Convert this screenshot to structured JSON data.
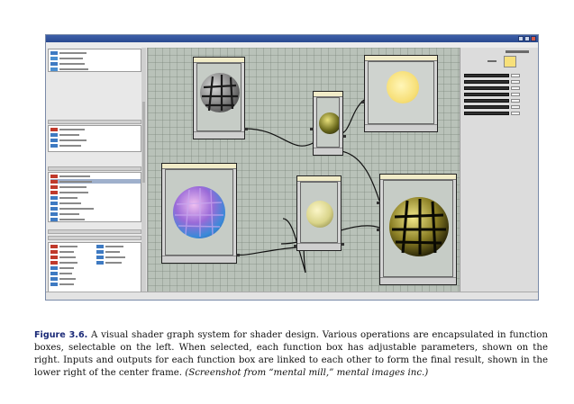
{
  "caption": {
    "label": "Figure 3.6.",
    "text": " A visual shader graph system for shader design. Various operations are encapsulated in function boxes, selectable on the left. When selected, each function box has adjustable parameters, shown on the right. Inputs and outputs for each function box are linked to each other to form the final result, shown in the lower right of the center frame. ",
    "credit": "(Screenshot from “mental mill,” mental images inc.)"
  },
  "colors": {
    "node_header": "#f1ecc8",
    "canvas": "#b9c2b9",
    "caption_label": "#1b2a78"
  },
  "icons": [
    "minimize-icon",
    "maximize-icon",
    "close-icon"
  ]
}
